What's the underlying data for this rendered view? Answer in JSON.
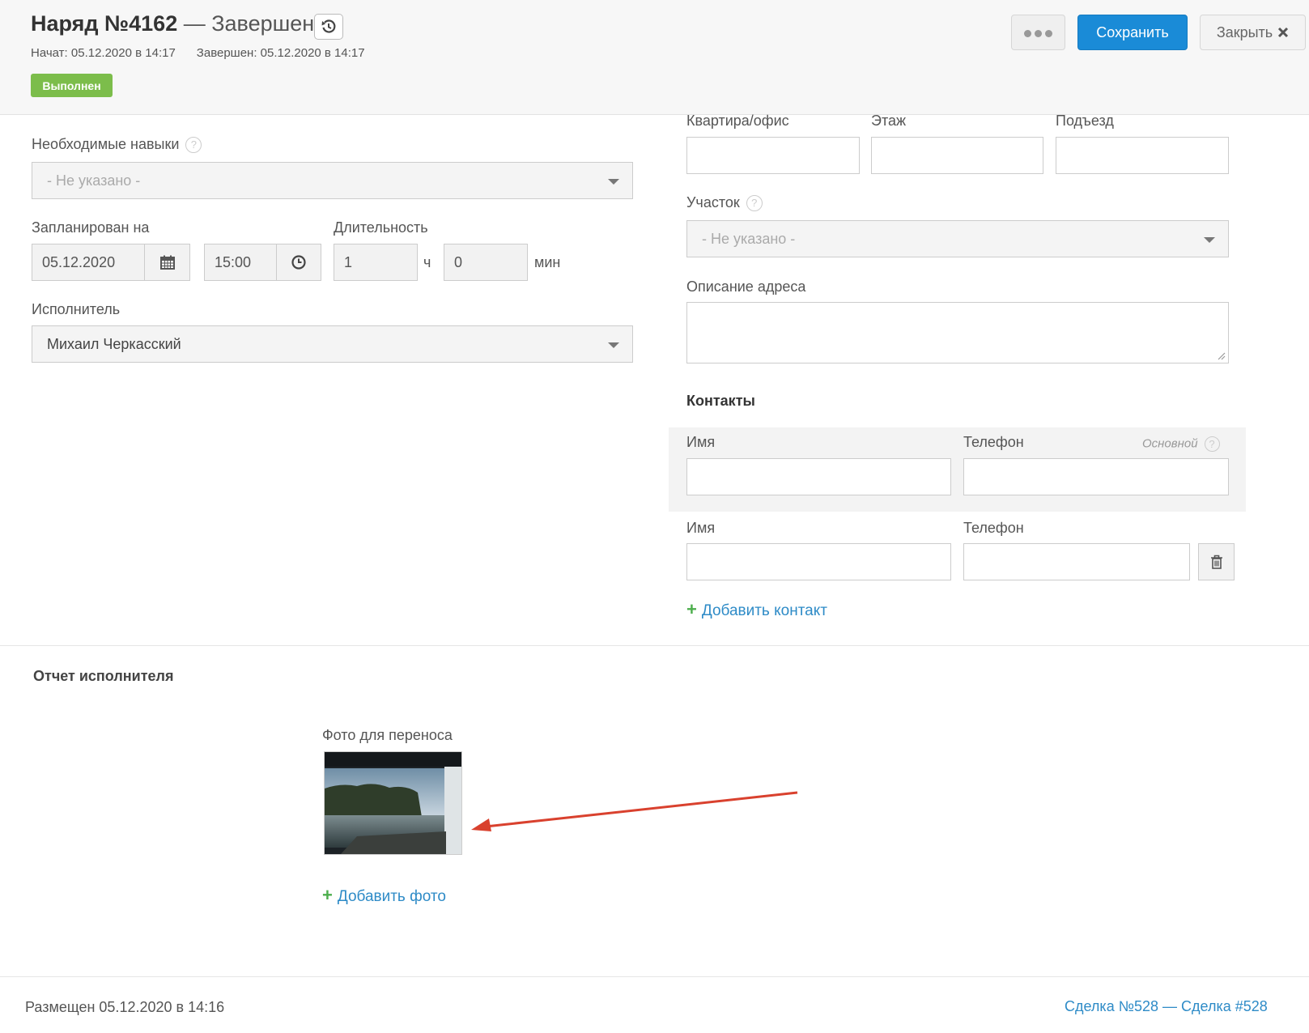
{
  "header": {
    "title_prefix": "Наряд №4162",
    "title_suffix": "— Завершен",
    "started": "Начат: 05.12.2020 в 14:17",
    "finished": "Завершен: 05.12.2020 в 14:17",
    "status_badge": "Выполнен",
    "save_label": "Сохранить",
    "close_label": "Закрыть"
  },
  "left": {
    "skills_label": "Необходимые навыки",
    "skills_value": "- Не указано -",
    "scheduled_label": "Запланирован на",
    "date_value": "05.12.2020",
    "time_value": "15:00",
    "duration_label": "Длительность",
    "hours_value": "1",
    "hours_unit": "ч",
    "minutes_value": "0",
    "minutes_unit": "мин",
    "executor_label": "Исполнитель",
    "executor_value": "Михаил Черкасский"
  },
  "right": {
    "apartment_label": "Квартира/офис",
    "floor_label": "Этаж",
    "entrance_label": "Подъезд",
    "area_label": "Участок",
    "area_value": "- Не указано -",
    "address_desc_label": "Описание адреса",
    "contacts_title": "Контакты",
    "contacts": [
      {
        "name_label": "Имя",
        "phone_label": "Телефон",
        "primary_label": "Основной"
      },
      {
        "name_label": "Имя",
        "phone_label": "Телефон"
      }
    ],
    "add_contact": "Добавить контакт"
  },
  "report": {
    "title": "Отчет исполнителя",
    "photo_label": "Фото для переноса",
    "add_photo": "Добавить фото"
  },
  "footer": {
    "placed": "Размещен 05.12.2020 в 14:16",
    "deal_link": "Сделка №528 — Сделка #528"
  },
  "colors": {
    "primary": "#1a8bd7",
    "success": "#7cbd4b",
    "link": "#2e8bc7",
    "annotation_arrow": "#d9412e"
  }
}
